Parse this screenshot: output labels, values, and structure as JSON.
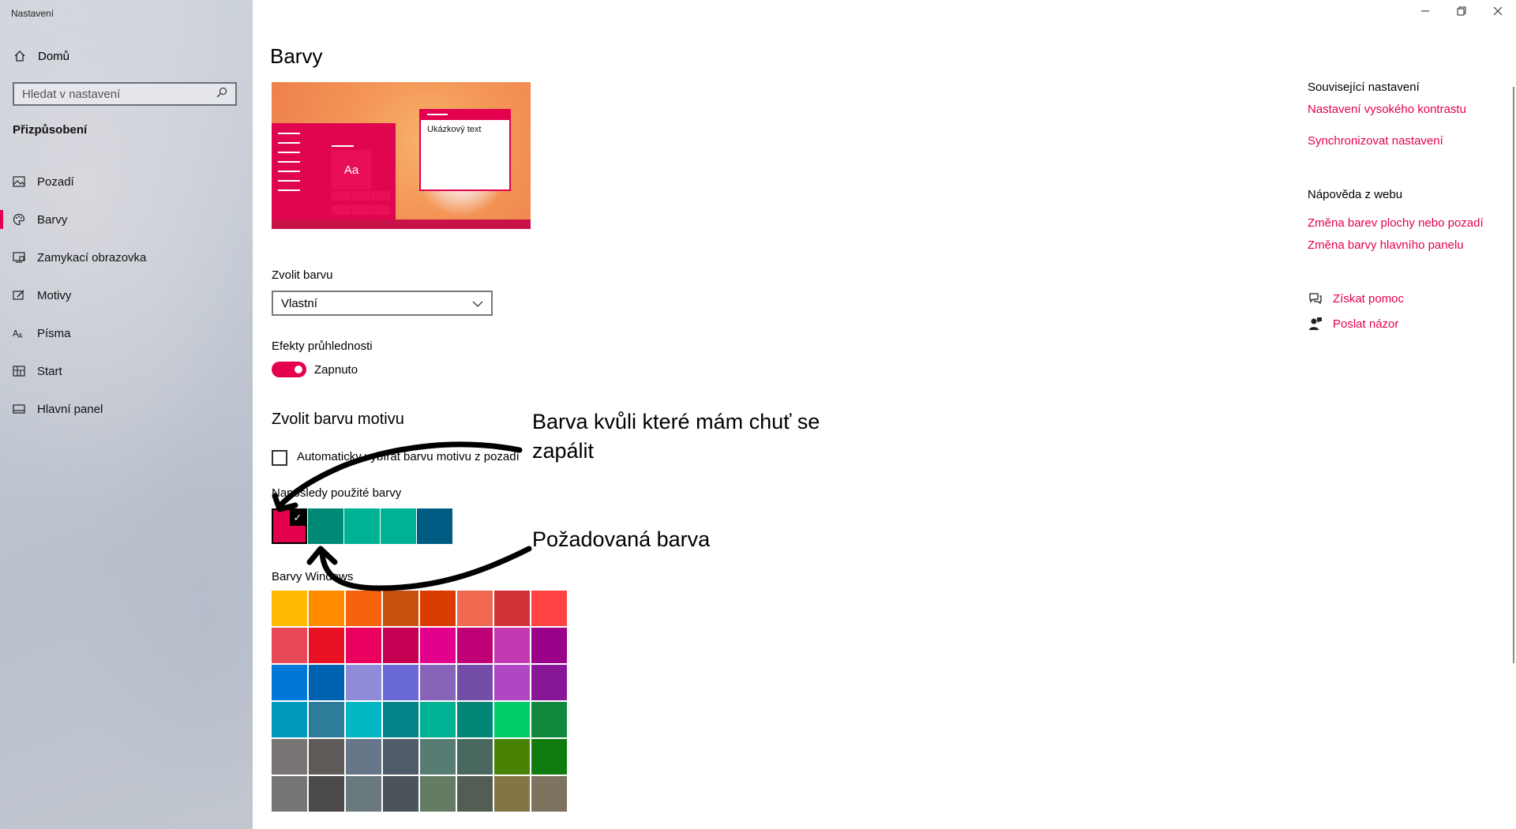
{
  "app": {
    "title": "Nastavení"
  },
  "window_controls": {
    "minimize": "minimize-icon",
    "restore": "restore-icon",
    "close": "close-icon"
  },
  "sidebar": {
    "home": "Domů",
    "search_placeholder": "Hledat v nastavení",
    "section": "Přizpůsobení",
    "items": [
      {
        "label": "Pozadí",
        "icon": "picture-icon"
      },
      {
        "label": "Barvy",
        "icon": "palette-icon",
        "active": true
      },
      {
        "label": "Zamykací obrazovka",
        "icon": "lock-screen-icon"
      },
      {
        "label": "Motivy",
        "icon": "themes-icon"
      },
      {
        "label": "Písma",
        "icon": "fonts-icon"
      },
      {
        "label": "Start",
        "icon": "start-icon"
      },
      {
        "label": "Hlavní panel",
        "icon": "taskbar-icon"
      }
    ]
  },
  "main": {
    "title": "Barvy",
    "preview": {
      "sample_text": "Ukázkový text",
      "tile_text": "Aa"
    },
    "choose_color_label": "Zvolit barvu",
    "choose_color_value": "Vlastní",
    "transparency_label": "Efekty průhlednosti",
    "transparency_state": "Zapnuto",
    "accent_heading": "Zvolit barvu motivu",
    "auto_pick_label": "Automaticky vybírat barvu motivu z pozadí",
    "recent_label": "Naposledy použité barvy",
    "recent_colors": [
      "#e3004f",
      "#008a76",
      "#00b294",
      "#00b294",
      "#005b83"
    ],
    "windows_colors_label": "Barvy Windows",
    "windows_colors": [
      "#ffb900",
      "#ff8c00",
      "#f7630c",
      "#ca5010",
      "#da3b01",
      "#ef6950",
      "#d13438",
      "#ff4343",
      "#e74856",
      "#e81123",
      "#ea005e",
      "#c30052",
      "#e3008c",
      "#bf0077",
      "#c239b3",
      "#9a0089",
      "#0078d7",
      "#0063b1",
      "#8e8cd8",
      "#6b69d6",
      "#8764b8",
      "#744da9",
      "#b146c2",
      "#881798",
      "#0099bc",
      "#2d7d9a",
      "#00b7c3",
      "#038387",
      "#00b294",
      "#018574",
      "#00cc6a",
      "#10893e",
      "#7a7574",
      "#5d5a58",
      "#68768a",
      "#515c6b",
      "#567c73",
      "#486860",
      "#498205",
      "#107c10",
      "#767676",
      "#4c4a48",
      "#69797e",
      "#4a5459",
      "#647c64",
      "#525e54",
      "#847545",
      "#7e735f"
    ]
  },
  "annotations": {
    "top_line1": "Barva kvůli které mám chuť se",
    "top_line2": "zapálit",
    "bottom": "Požadovaná barva"
  },
  "right_panel": {
    "related_heading": "Související nastavení",
    "related_links": [
      "Nastavení vysokého kontrastu",
      "Synchronizovat nastavení"
    ],
    "web_help_heading": "Nápověda z webu",
    "web_help_links": [
      "Změna barev plochy nebo pozadí",
      "Změna barvy hlavního panelu"
    ],
    "get_help": "Získat pomoc",
    "feedback": "Poslat názor"
  },
  "colors": {
    "accent": "#e3004f"
  }
}
